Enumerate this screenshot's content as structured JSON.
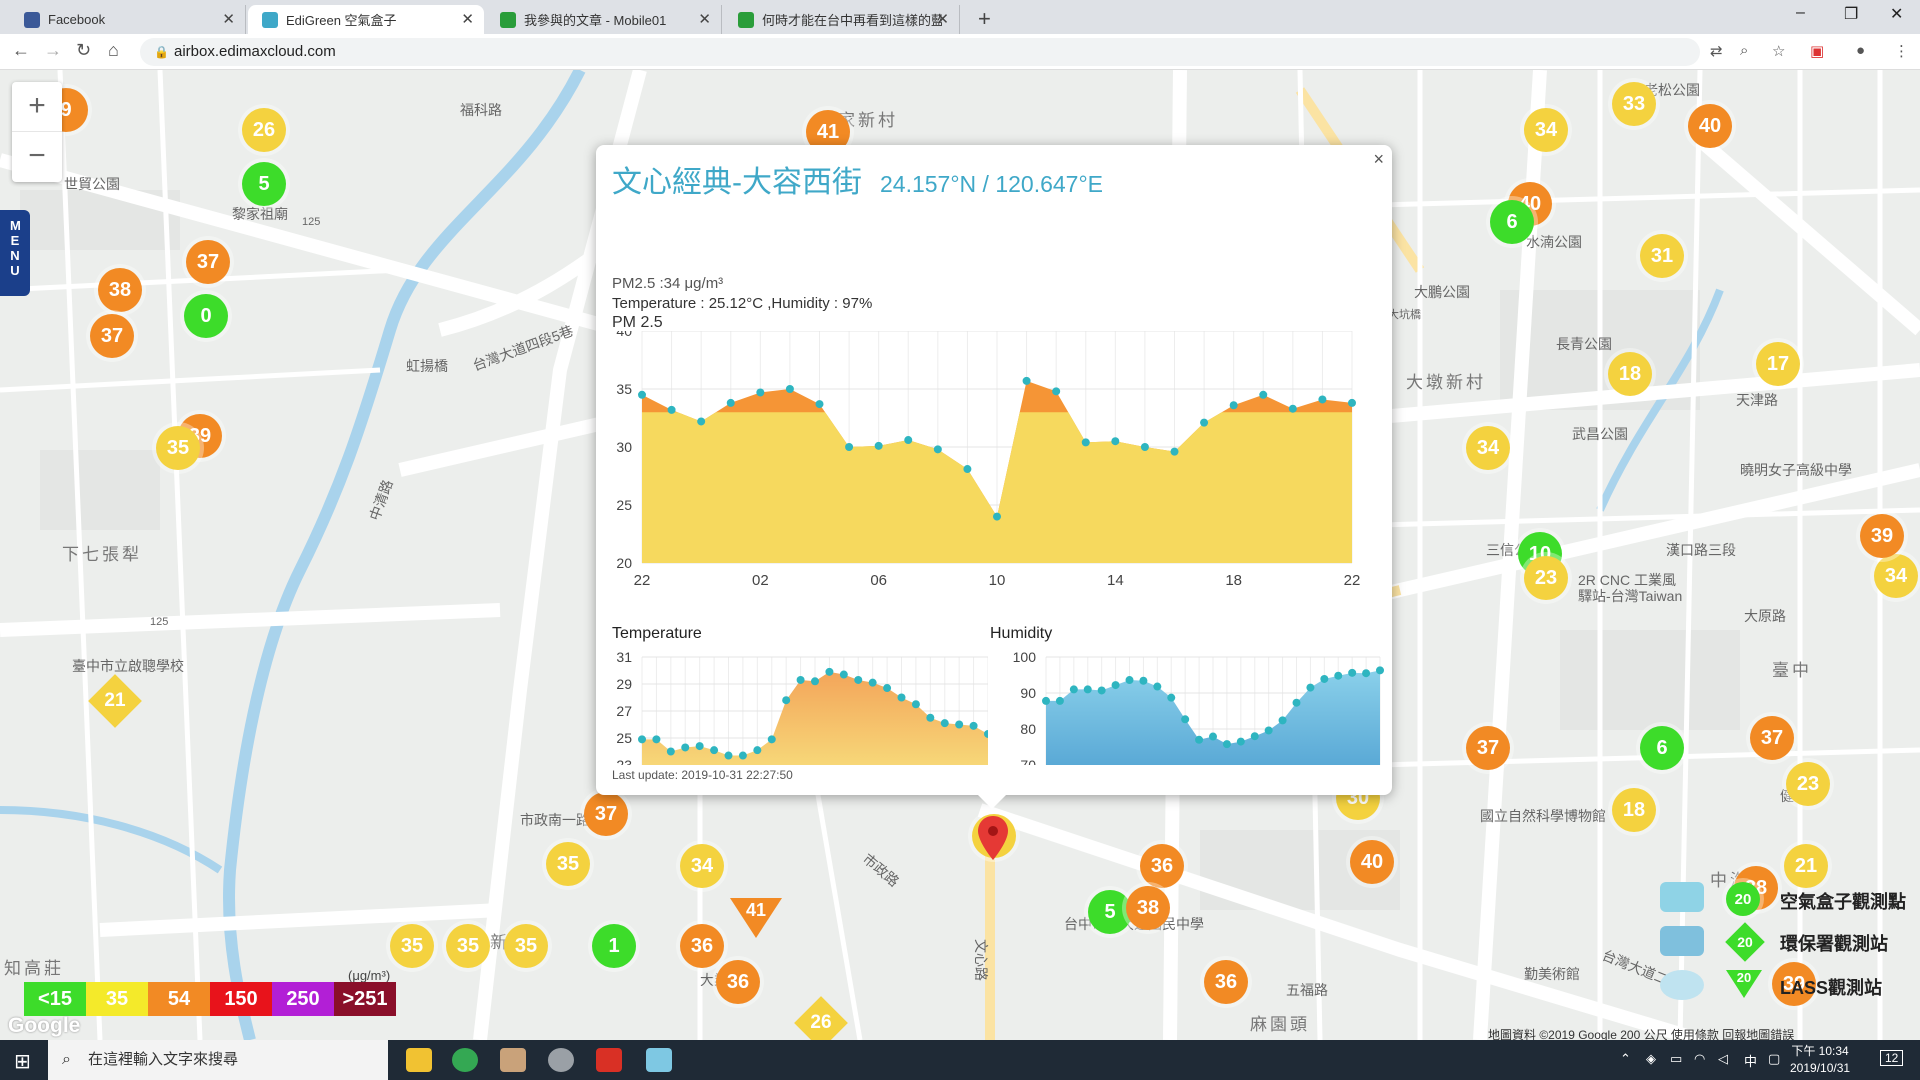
{
  "browser": {
    "tabs": [
      {
        "title": "Facebook",
        "color": "#3b5998"
      },
      {
        "title": "EdiGreen 空氣盒子",
        "color": "#3fa8c8"
      },
      {
        "title": "我參與的文章 - Mobile01",
        "color": "#2a9d3a"
      },
      {
        "title": "何時才能在台中再看到這樣的藍",
        "color": "#2a9d3a"
      }
    ],
    "url": "airbox.edimaxcloud.com"
  },
  "map": {
    "menu_label": "MENU",
    "zoom_in": "+",
    "zoom_out": "−",
    "labels": [
      "福科路",
      "世貿公園",
      "黎家祖廟",
      "125",
      "下七張犁",
      "虹揚橋",
      "台灣大道四段5巷",
      "中清路",
      "臺中市立啟聰學校",
      "125",
      "知高莊",
      "惠家新村",
      "黎明新村",
      "市政南一路",
      "市政路",
      "文心路",
      "大業路",
      "台中市立大道國民中學",
      "國立自然科學博物館",
      "大鵬公園",
      "水湳公園",
      "長青公園",
      "天津路",
      "武昌公園",
      "曉明女子高級中學",
      "三信公園",
      "漢口路三段",
      "2R CNC 工業風",
      "驛站-台灣Taiwan",
      "大原路",
      "臺中",
      "健行路",
      "中海",
      "勤美術館",
      "台灣大道二段",
      "大坑橋",
      "老松公園",
      "大墩新村",
      "五福路",
      "麻園頭"
    ],
    "markers": [
      {
        "v": "26",
        "c": "yellow"
      },
      {
        "v": "5",
        "c": "green"
      },
      {
        "v": "9",
        "c": "orange"
      },
      {
        "v": "37",
        "c": "orange"
      },
      {
        "v": "38",
        "c": "orange"
      },
      {
        "v": "0",
        "c": "green"
      },
      {
        "v": "37",
        "c": "orange"
      },
      {
        "v": "39",
        "c": "orange"
      },
      {
        "v": "35",
        "c": "yellow"
      },
      {
        "v": "41",
        "c": "orange"
      },
      {
        "v": "34",
        "c": "yellow"
      },
      {
        "v": "33",
        "c": "yellow"
      },
      {
        "v": "40",
        "c": "orange"
      },
      {
        "v": "40",
        "c": "orange"
      },
      {
        "v": "6",
        "c": "green"
      },
      {
        "v": "31",
        "c": "yellow"
      },
      {
        "v": "18",
        "c": "yellow"
      },
      {
        "v": "17",
        "c": "yellow"
      },
      {
        "v": "34",
        "c": "yellow"
      },
      {
        "v": "10",
        "c": "green"
      },
      {
        "v": "23",
        "c": "yellow"
      },
      {
        "v": "34",
        "c": "yellow"
      },
      {
        "v": "37",
        "c": "orange"
      },
      {
        "v": "6",
        "c": "green"
      },
      {
        "v": "37",
        "c": "orange"
      },
      {
        "v": "23",
        "c": "yellow"
      },
      {
        "v": "18",
        "c": "yellow"
      },
      {
        "v": "21",
        "c": "yellow"
      },
      {
        "v": "30",
        "c": "yellow"
      },
      {
        "v": "37",
        "c": "orange"
      },
      {
        "v": "35",
        "c": "yellow"
      },
      {
        "v": "34",
        "c": "yellow"
      },
      {
        "v": "34",
        "c": "yellow"
      },
      {
        "v": "36",
        "c": "orange"
      },
      {
        "v": "40",
        "c": "orange"
      },
      {
        "v": "5",
        "c": "green"
      },
      {
        "v": "38",
        "c": "orange"
      },
      {
        "v": "35",
        "c": "yellow"
      },
      {
        "v": "35",
        "c": "yellow"
      },
      {
        "v": "35",
        "c": "yellow"
      },
      {
        "v": "1",
        "c": "green"
      },
      {
        "v": "36",
        "c": "orange"
      },
      {
        "v": "36",
        "c": "orange"
      },
      {
        "v": "36",
        "c": "orange"
      },
      {
        "v": "39",
        "c": "orange"
      },
      {
        "v": "38",
        "c": "orange"
      },
      {
        "v": "39",
        "c": "orange"
      }
    ],
    "diamonds": [
      "21",
      "26"
    ],
    "triangle": "41",
    "legend": [
      {
        "label": "<15",
        "color": "#3ddc2a"
      },
      {
        "label": "35",
        "color": "#f4ea2a"
      },
      {
        "label": "54",
        "color": "#f28a24"
      },
      {
        "label": "150",
        "color": "#e8131b"
      },
      {
        "label": "250",
        "color": "#b21fd6"
      },
      {
        "label": ">251",
        "color": "#8a0f2a"
      }
    ],
    "legend_unit": "(μg/m³)",
    "google": "Google",
    "attribution": "地圖資料 ©2019 Google   200 公尺   使用條款   回報地圖錯誤",
    "stations": [
      {
        "label": "空氣盒子觀測點",
        "value": "20"
      },
      {
        "label": "環保署觀測站",
        "value": "20"
      },
      {
        "label": "LASS觀測站",
        "value": "20"
      }
    ]
  },
  "popup": {
    "title": "文心經典-大容西街",
    "coords": "24.157°N / 120.647°E",
    "pm_line": "PM2.5 :34 μg/m³",
    "temp_line": "Temperature : 25.12°C ,Humidity : 97%",
    "chart_label": "PM 2.5",
    "temp_label": "Temperature",
    "hum_label": "Humidity",
    "last_update": "Last update: 2019-10-31 22:27:50",
    "close": "×"
  },
  "taskbar": {
    "search_placeholder": "在這裡輸入文字來搜尋",
    "time": "下午 10:34",
    "date": "2019/10/31",
    "notif": "12"
  },
  "chart_data": [
    {
      "type": "area",
      "title": "PM 2.5",
      "x_ticks": [
        "22",
        "02",
        "06",
        "10",
        "14",
        "18",
        "22"
      ],
      "ylim": [
        20,
        40
      ],
      "y_ticks": [
        20,
        25,
        30,
        35,
        40
      ],
      "values": [
        34.5,
        33.2,
        32.2,
        33.8,
        34.7,
        35.0,
        33.7,
        30.0,
        30.1,
        30.6,
        29.8,
        28.1,
        24.0,
        35.7,
        34.8,
        30.4,
        30.5,
        30.0,
        29.6,
        32.1,
        33.6,
        34.5,
        33.3,
        34.1,
        33.8
      ]
    },
    {
      "type": "area",
      "title": "Temperature",
      "ylim": [
        23,
        31
      ],
      "y_ticks": [
        23,
        25,
        27,
        29,
        31
      ],
      "values": [
        24.9,
        24.9,
        24.0,
        24.3,
        24.4,
        24.1,
        23.7,
        23.7,
        24.1,
        24.9,
        27.8,
        29.3,
        29.2,
        29.9,
        29.7,
        29.3,
        29.1,
        28.7,
        28.0,
        27.5,
        26.5,
        26.1,
        26.0,
        25.9,
        25.3
      ]
    },
    {
      "type": "area",
      "title": "Humidity",
      "ylim": [
        70,
        100
      ],
      "y_ticks": [
        70,
        80,
        90,
        100
      ],
      "values": [
        87.8,
        87.8,
        91.0,
        91.0,
        90.7,
        92.2,
        93.6,
        93.4,
        91.8,
        88.7,
        82.7,
        77.0,
        77.9,
        75.8,
        76.5,
        78.0,
        79.6,
        82.4,
        87.3,
        91.5,
        93.9,
        94.8,
        95.6,
        95.5,
        96.3
      ]
    }
  ]
}
